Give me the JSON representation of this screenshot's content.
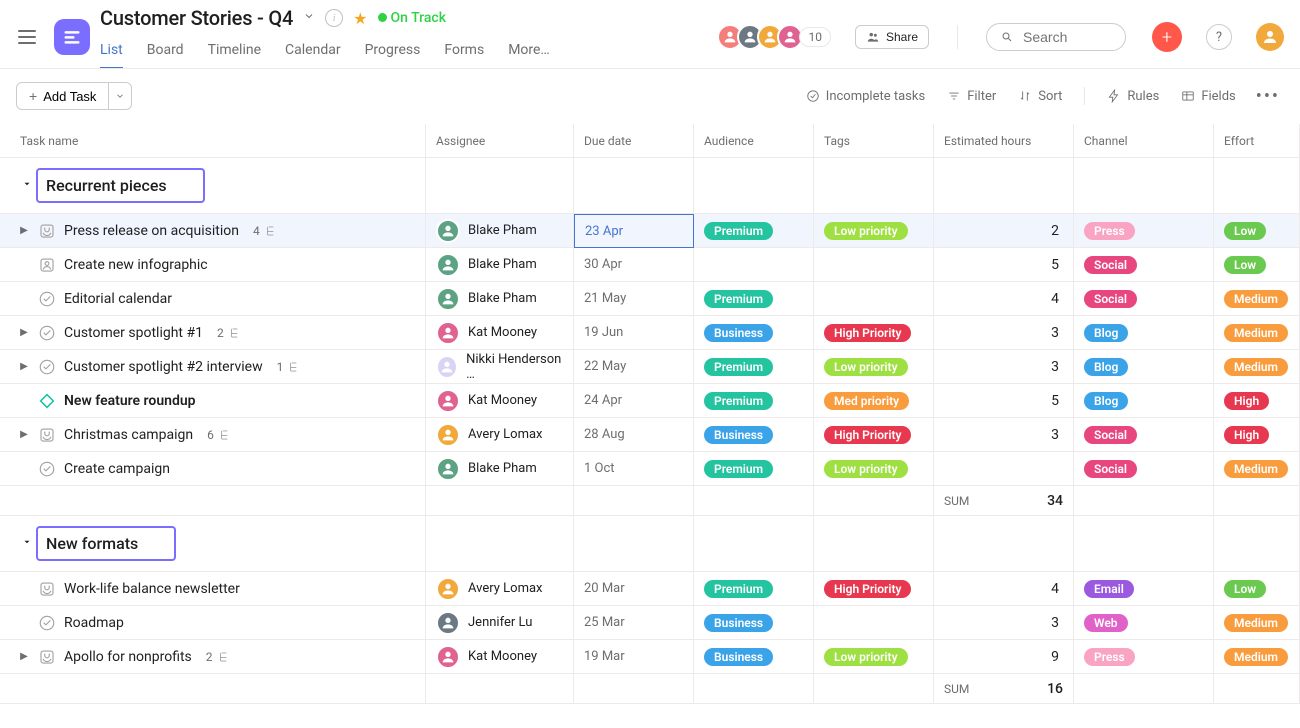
{
  "header": {
    "title": "Customer Stories - Q4",
    "status": "On Track",
    "collab_count": "10",
    "share": "Share",
    "search_placeholder": "Search",
    "tabs": [
      "List",
      "Board",
      "Timeline",
      "Calendar",
      "Progress",
      "Forms",
      "More…"
    ],
    "active_tab": 0
  },
  "toolbar": {
    "add_task": "Add Task",
    "incomplete": "Incomplete tasks",
    "filter": "Filter",
    "sort": "Sort",
    "rules": "Rules",
    "fields": "Fields"
  },
  "columns": [
    "Task name",
    "Assignee",
    "Due date",
    "Audience",
    "Tags",
    "Estimated hours",
    "Channel",
    "Effort"
  ],
  "sections": [
    {
      "name": "Recurrent pieces",
      "sum_label": "SUM",
      "sum_value": "34",
      "tasks": [
        {
          "icon": "approval",
          "name": "Press release on acquisition",
          "subtasks": "4",
          "expand": true,
          "selected": true,
          "assignee": "Blake Pham",
          "av": "blake",
          "due": "23 Apr",
          "audience": "Premium",
          "tag": "Low priority",
          "hours": "2",
          "channel": "Press",
          "effort": "Low"
        },
        {
          "icon": "person",
          "name": "Create new infographic",
          "subtasks": "",
          "expand": false,
          "assignee": "Blake Pham",
          "av": "blake",
          "due": "30 Apr",
          "audience": "",
          "tag": "",
          "hours": "5",
          "channel": "Social",
          "effort": "Low"
        },
        {
          "icon": "check",
          "name": "Editorial calendar",
          "subtasks": "",
          "expand": false,
          "assignee": "Blake Pham",
          "av": "blake",
          "due": "21 May",
          "audience": "Premium",
          "tag": "",
          "hours": "4",
          "channel": "Social",
          "effort": "Medium"
        },
        {
          "icon": "check",
          "name": "Customer spotlight #1",
          "subtasks": "2",
          "expand": true,
          "assignee": "Kat Mooney",
          "av": "kat",
          "due": "19 Jun",
          "audience": "Business",
          "tag": "High Priority",
          "hours": "3",
          "channel": "Blog",
          "effort": "Medium"
        },
        {
          "icon": "check",
          "name": "Customer spotlight #2 interview",
          "subtasks": "1",
          "expand": true,
          "assignee": "Nikki Henderson …",
          "av": "nikki",
          "due": "22 May",
          "audience": "Premium",
          "tag": "Low priority",
          "hours": "3",
          "channel": "Blog",
          "effort": "Medium"
        },
        {
          "icon": "milestone",
          "name": "New feature roundup",
          "subtasks": "",
          "expand": false,
          "bold": true,
          "assignee": "Kat Mooney",
          "av": "kat",
          "due": "24 Apr",
          "audience": "Premium",
          "tag": "Med priority",
          "hours": "5",
          "channel": "Blog",
          "effort": "High"
        },
        {
          "icon": "approval",
          "name": "Christmas campaign",
          "subtasks": "6",
          "expand": true,
          "assignee": "Avery Lomax",
          "av": "avery",
          "due": "28 Aug",
          "audience": "Business",
          "tag": "High Priority",
          "hours": "3",
          "channel": "Social",
          "effort": "High"
        },
        {
          "icon": "check",
          "name": "Create campaign",
          "subtasks": "",
          "expand": false,
          "assignee": "Blake Pham",
          "av": "blake",
          "due": "1 Oct",
          "audience": "Premium",
          "tag": "Low priority",
          "hours": "",
          "channel": "Social",
          "effort": "Medium"
        }
      ]
    },
    {
      "name": "New formats",
      "sum_label": "SUM",
      "sum_value": "16",
      "tasks": [
        {
          "icon": "approval",
          "name": "Work-life balance newsletter",
          "subtasks": "",
          "expand": false,
          "assignee": "Avery Lomax",
          "av": "avery",
          "due": "20 Mar",
          "audience": "Premium",
          "tag": "High Priority",
          "hours": "4",
          "channel": "Email",
          "effort": "Low"
        },
        {
          "icon": "check",
          "name": "Roadmap",
          "subtasks": "",
          "expand": false,
          "assignee": "Jennifer Lu",
          "av": "jenn",
          "due": "25 Mar",
          "audience": "Business",
          "tag": "",
          "hours": "3",
          "channel": "Web",
          "effort": "Medium"
        },
        {
          "icon": "approval",
          "name": "Apollo for nonprofits",
          "subtasks": "2",
          "expand": true,
          "assignee": "Kat Mooney",
          "av": "kat",
          "due": "19 Mar",
          "audience": "Business",
          "tag": "Low priority",
          "hours": "9",
          "channel": "Press",
          "effort": "Medium"
        }
      ]
    }
  ]
}
